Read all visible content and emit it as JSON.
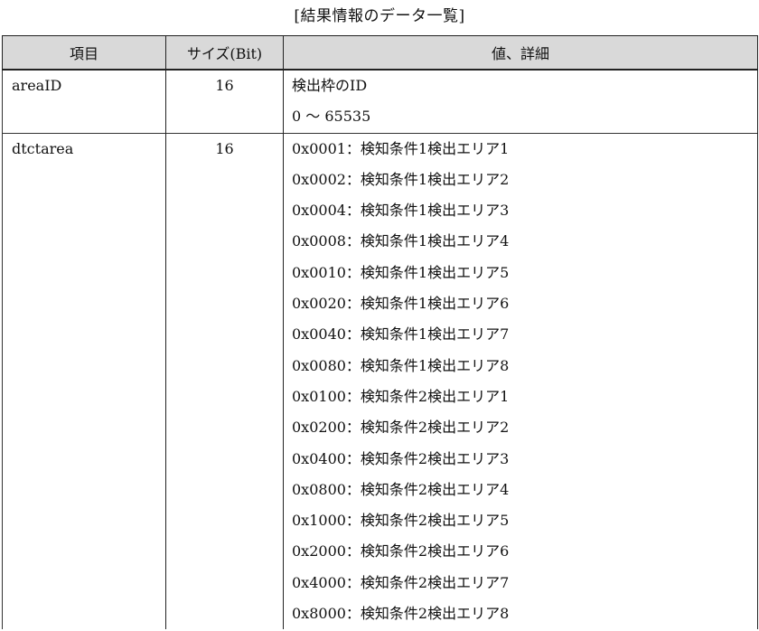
{
  "caption": "[結果情報のデータ一覧]",
  "table": {
    "headers": {
      "item": "項目",
      "size": "サイズ(Bit)",
      "detail": "値、詳細"
    },
    "rows": [
      {
        "name": "areaID",
        "size": "16",
        "details": [
          "検出枠のID",
          "0 〜 65535"
        ]
      },
      {
        "name": "dtctarea",
        "size": "16",
        "details": [
          "0x0001：検知条件1検出エリア1",
          "0x0002：検知条件1検出エリア2",
          "0x0004：検知条件1検出エリア3",
          "0x0008：検知条件1検出エリア4",
          "0x0010：検知条件1検出エリア5",
          "0x0020：検知条件1検出エリア6",
          "0x0040：検知条件1検出エリア7",
          "0x0080：検知条件1検出エリア8",
          "0x0100：検知条件2検出エリア1",
          "0x0200：検知条件2検出エリア2",
          "0x0400：検知条件2検出エリア3",
          "0x0800：検知条件2検出エリア4",
          "0x1000：検知条件2検出エリア5",
          "0x2000：検知条件2検出エリア6",
          "0x4000：検知条件2検出エリア7",
          "0x8000：検知条件2検出エリア8"
        ]
      }
    ]
  },
  "colors": {
    "header_background": "#d9d9d9",
    "border": "#222222",
    "text": "#111111"
  }
}
